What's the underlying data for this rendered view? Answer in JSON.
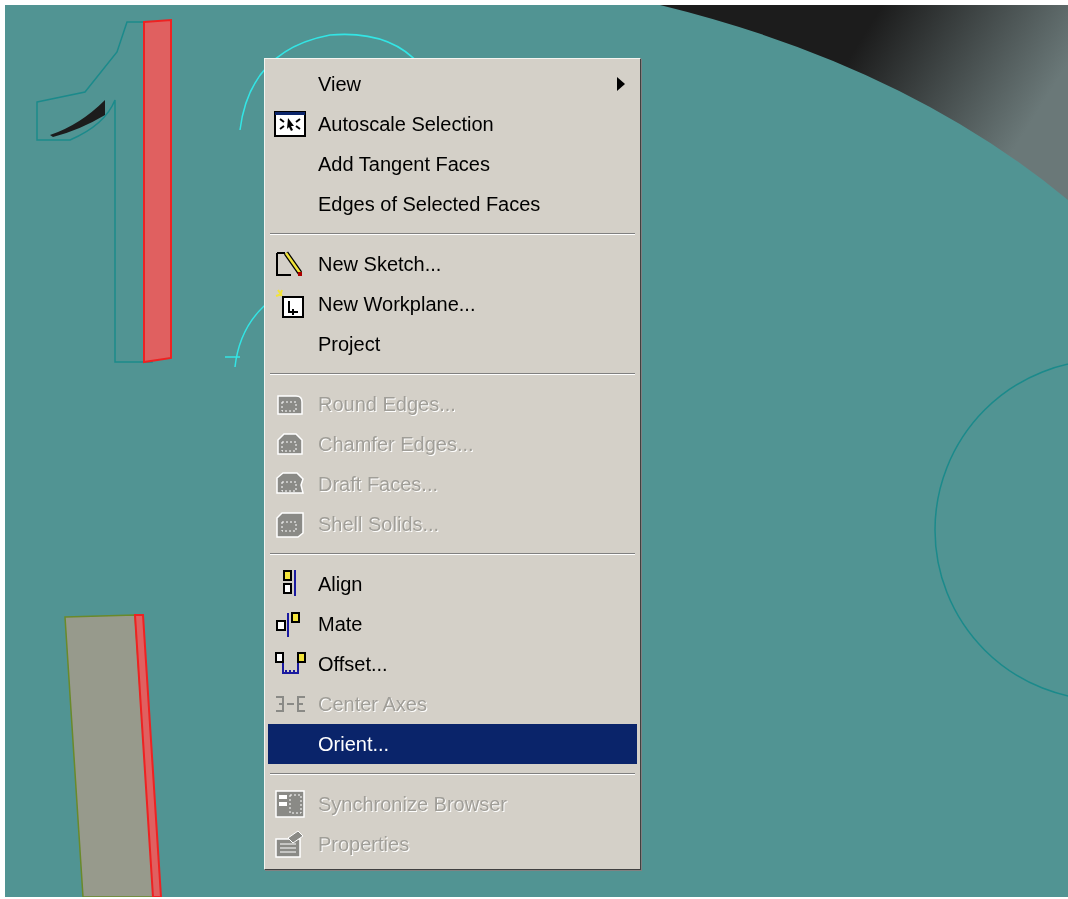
{
  "context_menu": {
    "sections": [
      {
        "items": [
          {
            "label": "View",
            "kind": "none",
            "disabled": false,
            "selected": false,
            "submenu": true
          },
          {
            "label": "Autoscale Selection",
            "kind": "autoscale",
            "disabled": false,
            "selected": false,
            "submenu": false
          },
          {
            "label": "Add Tangent Faces",
            "kind": "none",
            "disabled": false,
            "selected": false,
            "submenu": false
          },
          {
            "label": "Edges of Selected Faces",
            "kind": "none",
            "disabled": false,
            "selected": false,
            "submenu": false
          }
        ]
      },
      {
        "items": [
          {
            "label": "New Sketch...",
            "kind": "sketch",
            "disabled": false,
            "selected": false,
            "submenu": false
          },
          {
            "label": "New Workplane...",
            "kind": "workplane",
            "disabled": false,
            "selected": false,
            "submenu": false
          },
          {
            "label": "Project",
            "kind": "none",
            "disabled": false,
            "selected": false,
            "submenu": false
          }
        ]
      },
      {
        "items": [
          {
            "label": "Round Edges...",
            "kind": "round",
            "disabled": true,
            "selected": false,
            "submenu": false
          },
          {
            "label": "Chamfer Edges...",
            "kind": "chamfer",
            "disabled": true,
            "selected": false,
            "submenu": false
          },
          {
            "label": "Draft Faces...",
            "kind": "draft",
            "disabled": true,
            "selected": false,
            "submenu": false
          },
          {
            "label": "Shell Solids...",
            "kind": "shell",
            "disabled": true,
            "selected": false,
            "submenu": false
          }
        ]
      },
      {
        "items": [
          {
            "label": "Align",
            "kind": "align",
            "disabled": false,
            "selected": false,
            "submenu": false
          },
          {
            "label": "Mate",
            "kind": "mate",
            "disabled": false,
            "selected": false,
            "submenu": false
          },
          {
            "label": "Offset...",
            "kind": "offset",
            "disabled": false,
            "selected": false,
            "submenu": false
          },
          {
            "label": "Center Axes",
            "kind": "axes",
            "disabled": true,
            "selected": false,
            "submenu": false
          },
          {
            "label": "Orient...",
            "kind": "none",
            "disabled": false,
            "selected": true,
            "submenu": false
          }
        ]
      },
      {
        "items": [
          {
            "label": "Synchronize Browser",
            "kind": "sync",
            "disabled": true,
            "selected": false,
            "submenu": false
          },
          {
            "label": "Properties",
            "kind": "properties",
            "disabled": true,
            "selected": false,
            "submenu": false
          }
        ]
      }
    ]
  }
}
